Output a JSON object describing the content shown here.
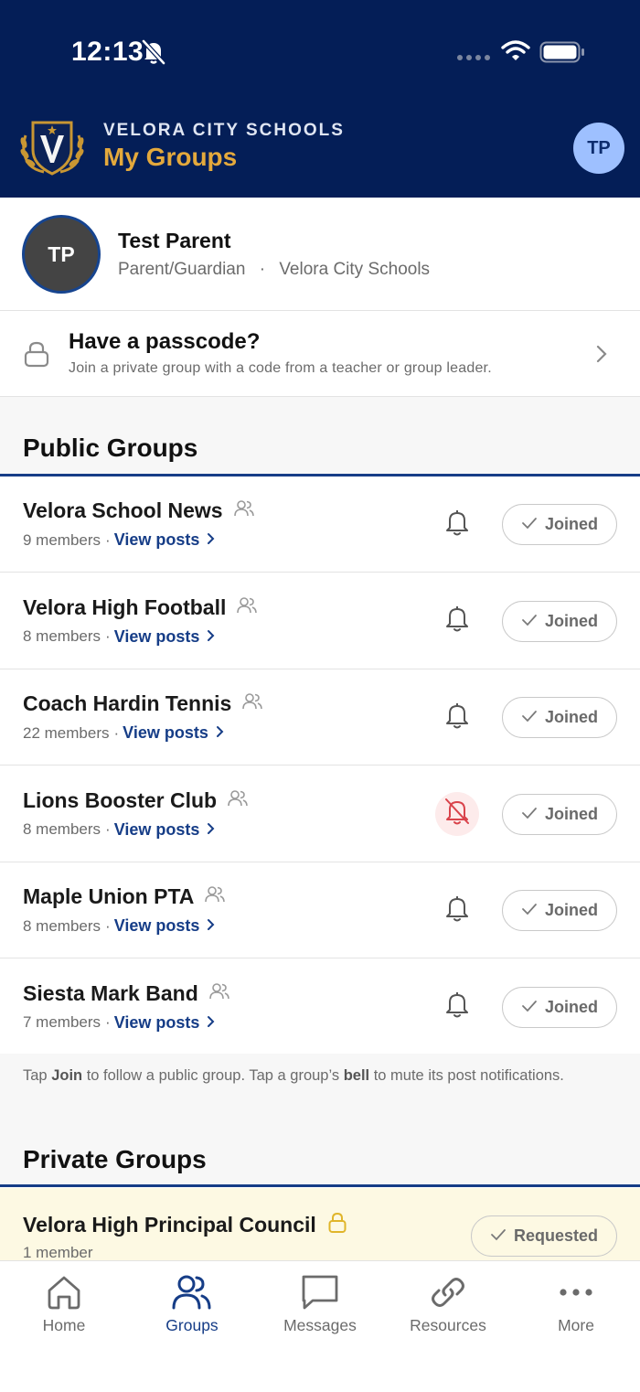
{
  "status_bar": {
    "time": "12:13"
  },
  "header": {
    "org_name": "VELORA CITY SCHOOLS",
    "title": "My Groups",
    "avatar_initials": "TP"
  },
  "profile": {
    "initials": "TP",
    "name": "Test Parent",
    "role": "Parent/Guardian",
    "separator": "·",
    "school": "Velora City Schools"
  },
  "passcode": {
    "title": "Have a passcode?",
    "subtitle": "Join a private group with a code from a teacher or group leader."
  },
  "public_groups": {
    "heading": "Public Groups",
    "items": [
      {
        "name": "Velora School News",
        "members": "9 members",
        "view_posts": "View posts",
        "status": "Joined",
        "muted": false
      },
      {
        "name": "Velora High Football",
        "members": "8 members",
        "view_posts": "View posts",
        "status": "Joined",
        "muted": false
      },
      {
        "name": "Coach Hardin Tennis",
        "members": "22 members",
        "view_posts": "View posts",
        "status": "Joined",
        "muted": false
      },
      {
        "name": "Lions Booster Club",
        "members": "8 members",
        "view_posts": "View posts",
        "status": "Joined",
        "muted": true
      },
      {
        "name": "Maple Union PTA",
        "members": "8 members",
        "view_posts": "View posts",
        "status": "Joined",
        "muted": false
      },
      {
        "name": "Siesta Mark Band",
        "members": "7 members",
        "view_posts": "View posts",
        "status": "Joined",
        "muted": false
      }
    ],
    "hint": {
      "part1": "Tap ",
      "join_word": "Join",
      "part2": " to follow a public group. Tap a group’s ",
      "bell_word": "bell",
      "part3": " to mute its post notifications."
    }
  },
  "private_groups": {
    "heading": "Private Groups",
    "items": [
      {
        "name": "Velora High Principal Council",
        "members": "1 member",
        "status": "Requested"
      }
    ]
  },
  "tabbar": {
    "items": [
      {
        "label": "Home",
        "icon": "home-icon"
      },
      {
        "label": "Groups",
        "icon": "groups-icon",
        "active": true
      },
      {
        "label": "Messages",
        "icon": "messages-icon"
      },
      {
        "label": "Resources",
        "icon": "link-icon"
      },
      {
        "label": "More",
        "icon": "more-icon"
      }
    ]
  },
  "colors": {
    "header_bg": "#041e57",
    "accent_gold": "#e4a93c",
    "brand_blue": "#163d87",
    "muted_red": "#d9434b",
    "private_bg": "#fdf9e3"
  }
}
